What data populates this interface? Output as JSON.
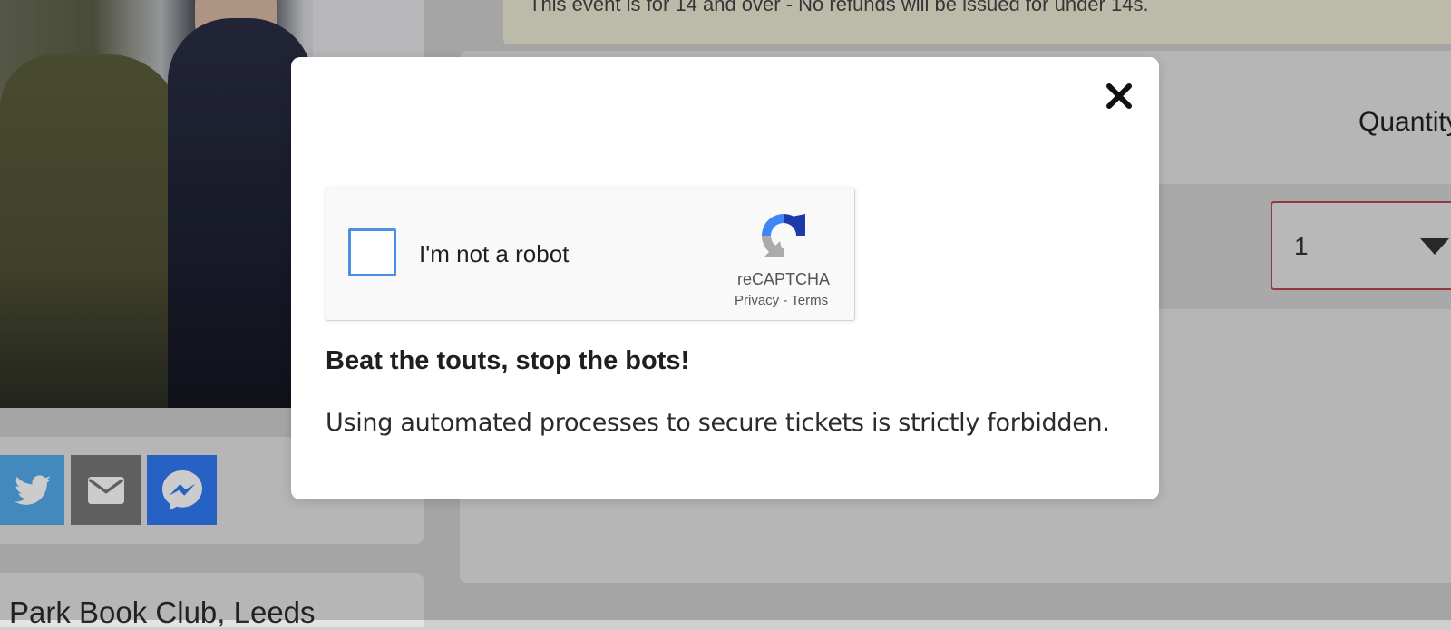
{
  "background": {
    "notice_text": "This event is for 14 and over - No refunds will be issued for under 14s.",
    "quantity_label": "Quantity",
    "quantity_value": "1",
    "venue_text": "Park Book Club, Leeds",
    "share_icons": [
      "twitter-icon",
      "email-icon",
      "messenger-icon"
    ]
  },
  "modal": {
    "close_icon": "close-icon",
    "recaptcha": {
      "label": "I'm not a robot",
      "brand": "reCAPTCHA",
      "privacy": "Privacy",
      "separator": "-",
      "terms": "Terms"
    },
    "heading": "Beat the touts, stop the bots!",
    "body": "Using automated processes to secure tickets is strictly forbidden."
  },
  "colors": {
    "checkbox_border": "#4a90e2",
    "twitter": "#55acee",
    "messenger": "#2f7bf5",
    "select_border": "#b9464a"
  }
}
